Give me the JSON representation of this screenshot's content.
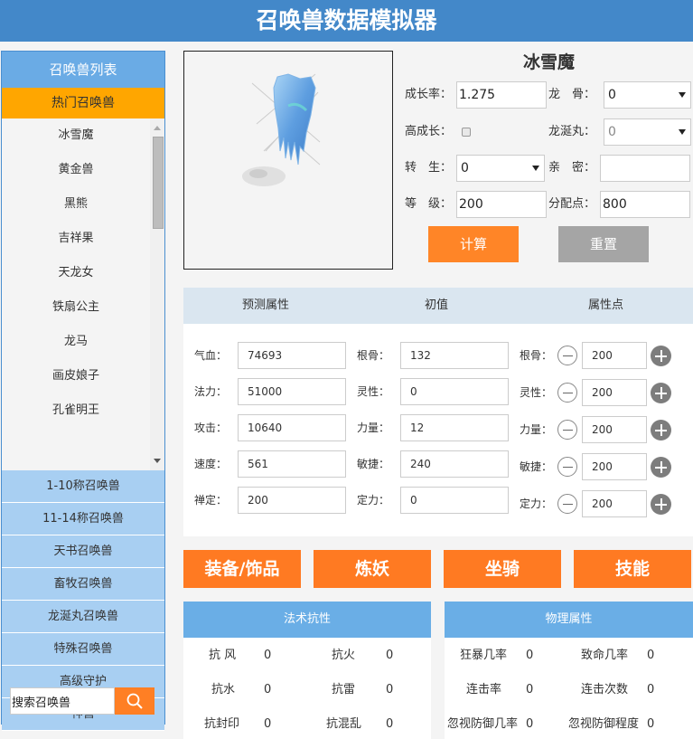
{
  "app": {
    "title": "召唤兽数据模拟器"
  },
  "sidebar": {
    "title": "召唤兽列表",
    "hot_label": "热门召唤兽",
    "pets": [
      "冰雪魔",
      "黄金兽",
      "黑熊",
      "吉祥果",
      "天龙女",
      "铁扇公主",
      "龙马",
      "画皮娘子",
      "孔雀明王"
    ],
    "categories": [
      "1-10称召唤兽",
      "11-14称召唤兽",
      "天书召唤兽",
      "畜牧召唤兽",
      "龙涎丸召唤兽",
      "特殊召唤兽",
      "高级守护",
      "神兽"
    ],
    "search": {
      "value": "搜索召唤兽",
      "button_icon": "search-icon"
    }
  },
  "pet": {
    "name": "冰雪魔",
    "image_alt": "冰雪魔 sprite"
  },
  "form": {
    "growth_label": "成长率：",
    "growth_value": "1.275",
    "dragon_bone_label": "龙　骨：",
    "dragon_bone_value": "0",
    "high_growth_label": "高成长：",
    "high_growth_checked": false,
    "dragon_pill_label": "龙涎丸：",
    "dragon_pill_value": "0",
    "rebirth_label": "转　生：",
    "rebirth_value": "0",
    "intimacy_label": "亲　密：",
    "intimacy_value": "",
    "level_label": "等　级：",
    "level_value": "200",
    "points_label": "分配点：",
    "points_value": "800",
    "calc_label": "计算",
    "reset_label": "重置"
  },
  "attributes": {
    "headers": [
      "预测属性",
      "初值",
      "属性点"
    ],
    "predicted": [
      {
        "label": "气血：",
        "value": "74693"
      },
      {
        "label": "法力：",
        "value": "51000"
      },
      {
        "label": "攻击：",
        "value": "10640"
      },
      {
        "label": "速度：",
        "value": "561"
      },
      {
        "label": "禅定：",
        "value": "200"
      }
    ],
    "initial": [
      {
        "label": "根骨：",
        "value": "132"
      },
      {
        "label": "灵性：",
        "value": "0"
      },
      {
        "label": "力量：",
        "value": "12"
      },
      {
        "label": "敏捷：",
        "value": "240"
      },
      {
        "label": "定力：",
        "value": "0"
      }
    ],
    "points": [
      {
        "label": "根骨：",
        "value": "200"
      },
      {
        "label": "灵性：",
        "value": "200"
      },
      {
        "label": "力量：",
        "value": "200"
      },
      {
        "label": "敏捷：",
        "value": "200"
      },
      {
        "label": "定力：",
        "value": "200"
      }
    ]
  },
  "tabs": [
    "装备/饰品",
    "炼妖",
    "坐骑",
    "技能"
  ],
  "magic_resist": {
    "title": "法术抗性",
    "items": [
      {
        "label": "抗 风",
        "value": "0"
      },
      {
        "label": "抗火",
        "value": "0"
      },
      {
        "label": "抗水",
        "value": "0"
      },
      {
        "label": "抗雷",
        "value": "0"
      },
      {
        "label": "抗封印",
        "value": "0"
      },
      {
        "label": "抗混乱",
        "value": "0"
      }
    ]
  },
  "physical": {
    "title": "物理属性",
    "items": [
      {
        "label": "狂暴几率",
        "value": "0"
      },
      {
        "label": "致命几率",
        "value": "0"
      },
      {
        "label": "连击率",
        "value": "0"
      },
      {
        "label": "连击次数",
        "value": "0"
      },
      {
        "label": "忽视防御几率",
        "value": "0"
      },
      {
        "label": "忽视防御程度",
        "value": "0"
      }
    ]
  },
  "colors": {
    "header": "#4388c9",
    "hot": "#ffa600",
    "category": "#a8cff2",
    "accent": "#ff7a22",
    "panel_head": "#6aaee6"
  }
}
